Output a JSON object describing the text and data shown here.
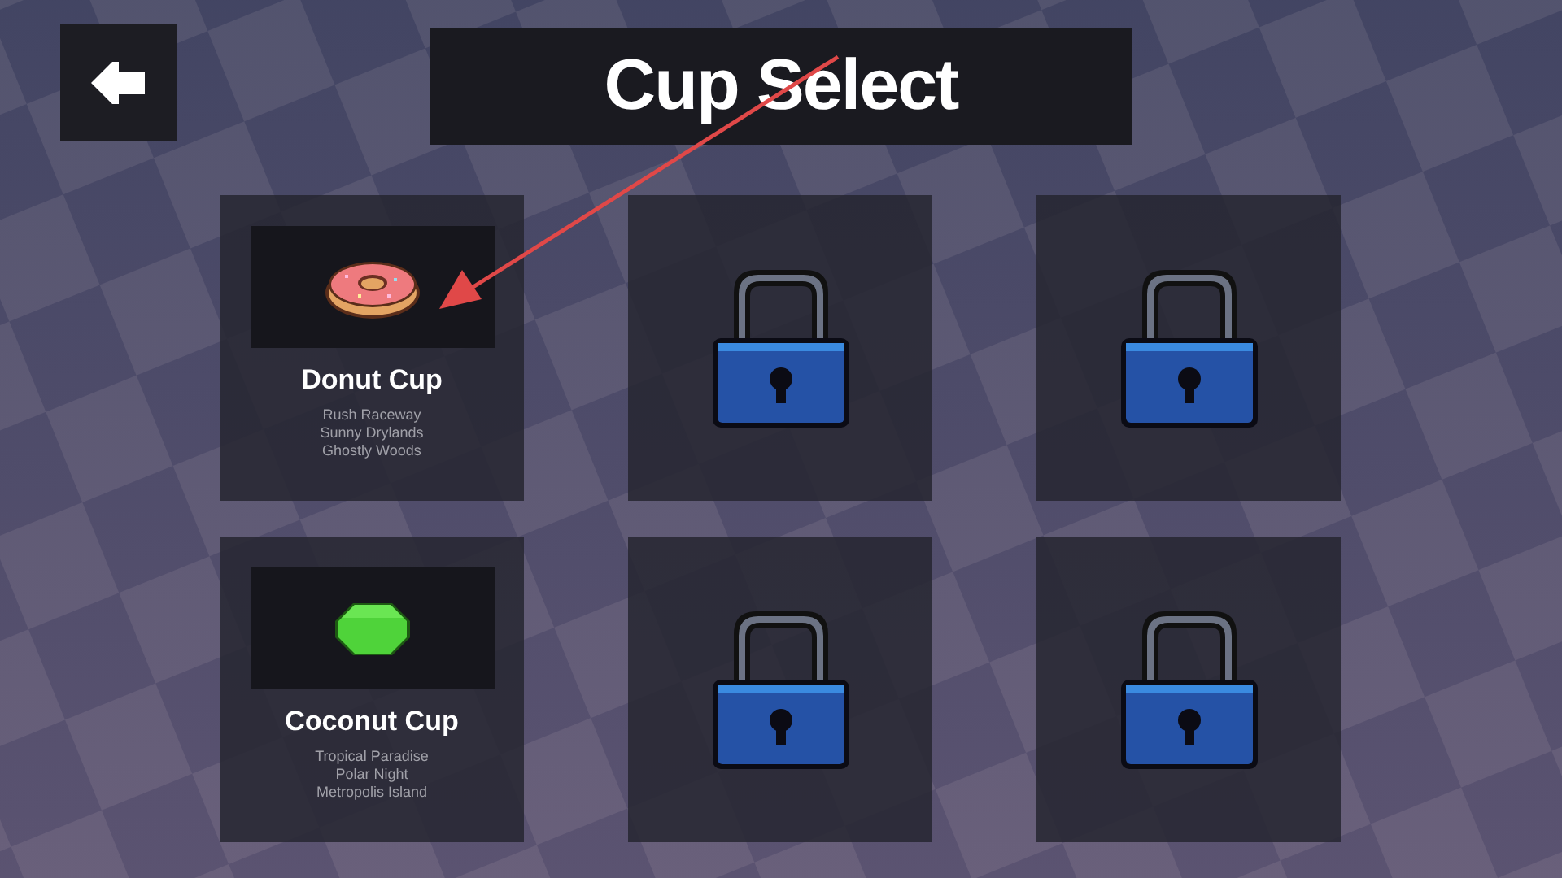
{
  "title": "Cup Select",
  "cups": [
    {
      "kind": "donut",
      "name": "Donut Cup",
      "tracks": [
        "Rush Raceway",
        "Sunny Drylands",
        "Ghostly Woods"
      ]
    },
    {
      "kind": "locked"
    },
    {
      "kind": "locked"
    },
    {
      "kind": "gem",
      "name": "Coconut Cup",
      "tracks": [
        "Tropical Paradise",
        "Polar Night",
        "Metropolis Island"
      ]
    },
    {
      "kind": "locked"
    },
    {
      "kind": "locked"
    }
  ]
}
